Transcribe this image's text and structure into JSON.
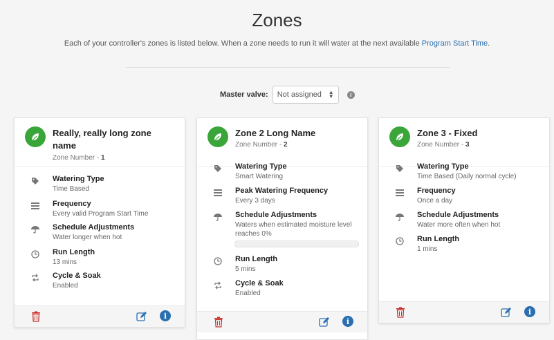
{
  "page": {
    "title": "Zones",
    "subtitle": "Each of your controller's zones is listed below. When a zone needs to run it will water at the next available ",
    "subtitle_link": "Program Start Time",
    "subtitle_end": "."
  },
  "master_valve": {
    "label": "Master valve:",
    "selected": "Not assigned"
  },
  "zones": [
    {
      "name": "Really, really long zone name",
      "number_label": "Zone Number - ",
      "number": "1",
      "rows": [
        {
          "label": "Watering Type",
          "value": "Time Based"
        },
        {
          "label": "Frequency",
          "value": "Every valid Program Start Time"
        },
        {
          "label": "Schedule Adjustments",
          "value": "Water longer when hot"
        },
        {
          "label": "Run Length",
          "value": "13 mins"
        },
        {
          "label": "Cycle & Soak",
          "value": "Enabled"
        }
      ]
    },
    {
      "name": "Zone 2 Long Name",
      "number_label": "Zone Number - ",
      "number": "2",
      "moisture_progress": 0,
      "rows": [
        {
          "label": "Watering Type",
          "value": "Smart Watering"
        },
        {
          "label": "Peak Watering Frequency",
          "value": "Every 3 days"
        },
        {
          "label": "Schedule Adjustments",
          "value": "Waters when estimated moisture level reaches 0%"
        },
        {
          "label": "Run Length",
          "value": "5 mins"
        },
        {
          "label": "Cycle & Soak",
          "value": "Enabled"
        }
      ]
    },
    {
      "name": "Zone 3 - Fixed",
      "number_label": "Zone Number - ",
      "number": "3",
      "rows": [
        {
          "label": "Watering Type",
          "value": "Time Based (Daily normal cycle)"
        },
        {
          "label": "Frequency",
          "value": "Once a day"
        },
        {
          "label": "Schedule Adjustments",
          "value": "Water more often when hot"
        },
        {
          "label": "Run Length",
          "value": "1 mins"
        }
      ]
    }
  ],
  "colors": {
    "leaf": "#3aa63a",
    "link": "#2a6fb0",
    "delete": "#c9302c",
    "icon": "#777777"
  },
  "icons": [
    "leaf-icon",
    "tag-icon",
    "frequency-icon",
    "umbrella-icon",
    "clock-icon",
    "cycle-icon",
    "trash-icon",
    "edit-icon",
    "info-icon"
  ]
}
